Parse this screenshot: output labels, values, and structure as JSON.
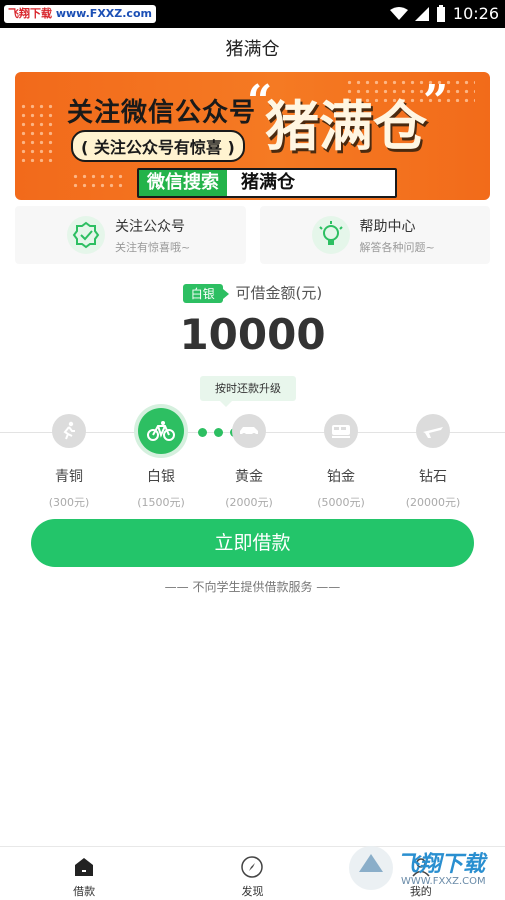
{
  "status_bar": {
    "left_badge_a": "飞翔下载",
    "left_badge_b": "www.FXXZ.com",
    "time": "10:26"
  },
  "title": "猪满仓",
  "banner": {
    "line1": "关注微信公众号",
    "line2": "( 关注公众号有惊喜 )",
    "brand": "猪满仓",
    "search_tag": "微信搜索",
    "search_text": "猪满仓"
  },
  "cards": [
    {
      "title": "关注公众号",
      "subtitle": "关注有惊喜哦~",
      "icon": "badge-check-icon"
    },
    {
      "title": "帮助中心",
      "subtitle": "解答各种问题~",
      "icon": "lightbulb-icon"
    }
  ],
  "current_tier": "白银",
  "amount_label": "可借金额(元)",
  "amount": "10000",
  "upgrade_tip": "按时还款升级",
  "levels": [
    {
      "name": "青铜",
      "limit": "(300元)",
      "icon": "runner-icon",
      "active": false
    },
    {
      "name": "白银",
      "limit": "(1500元)",
      "icon": "bicycle-icon",
      "active": true
    },
    {
      "name": "黄金",
      "limit": "(2000元)",
      "icon": "car-icon",
      "active": false
    },
    {
      "name": "铂金",
      "limit": "(5000元)",
      "icon": "train-icon",
      "active": false
    },
    {
      "name": "钻石",
      "limit": "(20000元)",
      "icon": "airplane-icon",
      "active": false
    }
  ],
  "borrow_button": "立即借款",
  "notice": "—— 不向学生提供借款服务 ——",
  "tabs": [
    {
      "label": "借款",
      "icon": "home-icon"
    },
    {
      "label": "发现",
      "icon": "compass-icon"
    },
    {
      "label": "我的",
      "icon": "user-icon"
    }
  ],
  "watermark": {
    "text": "飞翔下载",
    "url": "WWW.FXXZ.COM"
  },
  "colors": {
    "primary_green": "#23c56a",
    "banner_orange": "#f26a1b"
  }
}
